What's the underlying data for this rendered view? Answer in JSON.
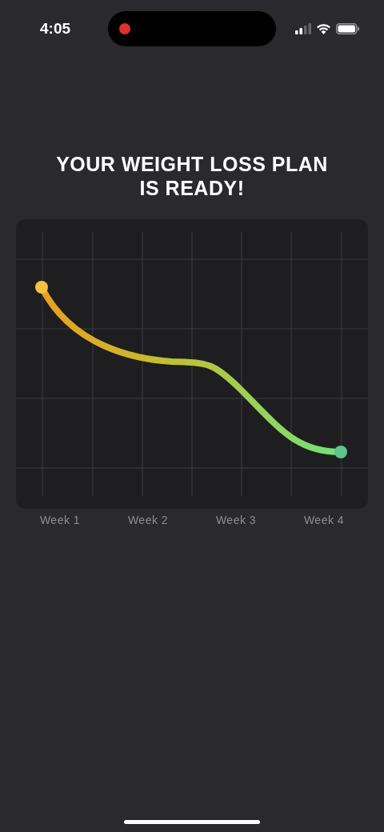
{
  "status_bar": {
    "time": "4:05",
    "recording": true
  },
  "title": "YOUR WEIGHT LOSS PLAN IS READY!",
  "chart": {
    "x_labels": [
      "Week 1",
      "Week 2",
      "Week 3",
      "Week 4"
    ]
  }
}
